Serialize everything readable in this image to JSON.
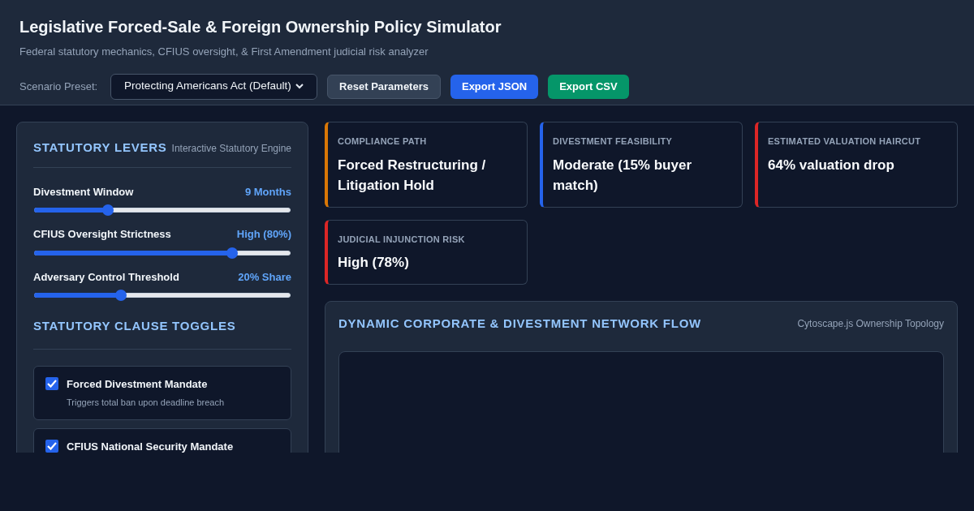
{
  "header": {
    "title": "Legislative Forced-Sale & Foreign Ownership Policy Simulator",
    "subtitle": "Federal statutory mechanics, CFIUS oversight, & First Amendment judicial risk analyzer",
    "preset_label": "Scenario Preset:",
    "preset_value": "Protecting Americans Act (Default)",
    "buttons": [
      {
        "label": "Reset Parameters",
        "kind": "secondary"
      },
      {
        "label": "Export JSON",
        "kind": "primary"
      },
      {
        "label": "Export CSV",
        "kind": "success"
      }
    ]
  },
  "levers": {
    "title": "STATUTORY LEVERS",
    "subtitle": "Interactive Statutory Engine",
    "sliders": [
      {
        "label": "Divestment Window",
        "reading": "9 Months",
        "level": 0.29
      },
      {
        "label": "CFIUS Oversight Strictness",
        "reading": "High (80%)",
        "level": 0.77
      },
      {
        "label": "Adversary Control Threshold",
        "reading": "20% Share",
        "level": 0.34
      }
    ]
  },
  "toggles": {
    "title": "STATUTORY CLAUSE TOGGLES",
    "items": [
      {
        "label": "Forced Divestment Mandate",
        "description": "Triggers total ban upon deadline breach",
        "checked": true
      },
      {
        "label": "CFIUS National Security Mandate",
        "checked": true
      }
    ]
  },
  "metrics": [
    {
      "label": "COMPLIANCE PATH",
      "value": "Forced Restructuring / Litigation Hold",
      "color": "#d97706"
    },
    {
      "label": "DIVESTMENT FEASIBILITY",
      "value": "Moderate (15% buyer match)",
      "color": "#2563eb"
    },
    {
      "label": "ESTIMATED VALUATION HAIRCUT",
      "value": "64% valuation drop",
      "color": "#dc2626"
    },
    {
      "label": "JUDICIAL INJUNCTION RISK",
      "value": "High (78%)",
      "color": "#dc2626"
    }
  ],
  "network": {
    "title": "DYNAMIC CORPORATE & DIVESTMENT NETWORK FLOW",
    "subtitle": "Cytoscape.js Ownership Topology"
  }
}
